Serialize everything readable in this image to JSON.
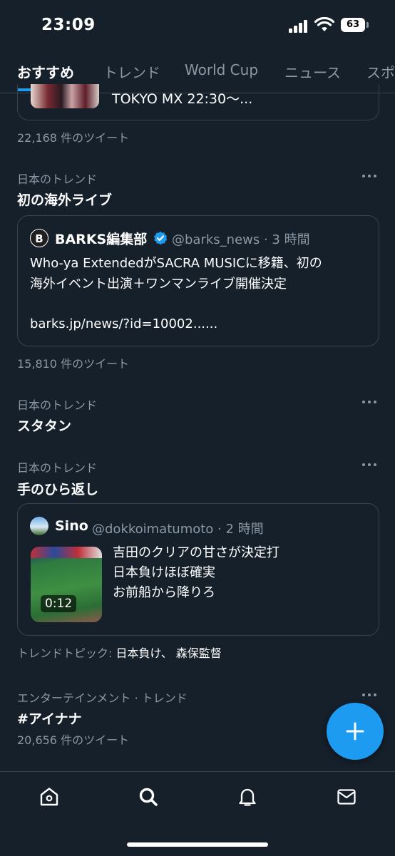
{
  "status_bar": {
    "time": "23:09",
    "battery": "63"
  },
  "tabs": [
    "おすすめ",
    "トレンド",
    "World Cup",
    "ニュース",
    "スポ"
  ],
  "top_card": {
    "text": "TOKYO MX  22:30～..."
  },
  "top_count": "22,168 件のツイート",
  "trends": [
    {
      "category": "日本のトレンド",
      "name": "初の海外ライブ",
      "count": "15,810 件のツイート"
    },
    {
      "category": "日本のトレンド",
      "name": "スタタン"
    },
    {
      "category": "日本のトレンド",
      "name": "手のひら返し",
      "topics_label": "トレンドトピック:",
      "topics": "日本負け、 森保監督"
    },
    {
      "category": "エンターテインメント · トレンド",
      "name": "#アイナナ",
      "count": "20,656 件のツイート"
    }
  ],
  "quote1": {
    "avatar_letter": "B",
    "name": "BARKS編集部",
    "handle": "@barks_news · 3 時間",
    "text_line1": "Who-ya ExtendedがSACRA MUSICに移籍、初の",
    "text_line2": "海外イベント出演＋ワンマンライブ開催決定",
    "link": "barks.jp/news/?id=10002......"
  },
  "quote2": {
    "name": "Sino",
    "handle": "@dokkoimatumoto · 2 時間",
    "text_line1": "吉田のクリアの甘さが決定打",
    "text_line2": "日本負けほぼ確実",
    "text_line3": "お前船から降りろ",
    "video_duration": "0:12"
  },
  "colors": {
    "background": "#15202b",
    "accent": "#1d9bf0",
    "muted": "#8b98a5",
    "border": "#38444d"
  }
}
